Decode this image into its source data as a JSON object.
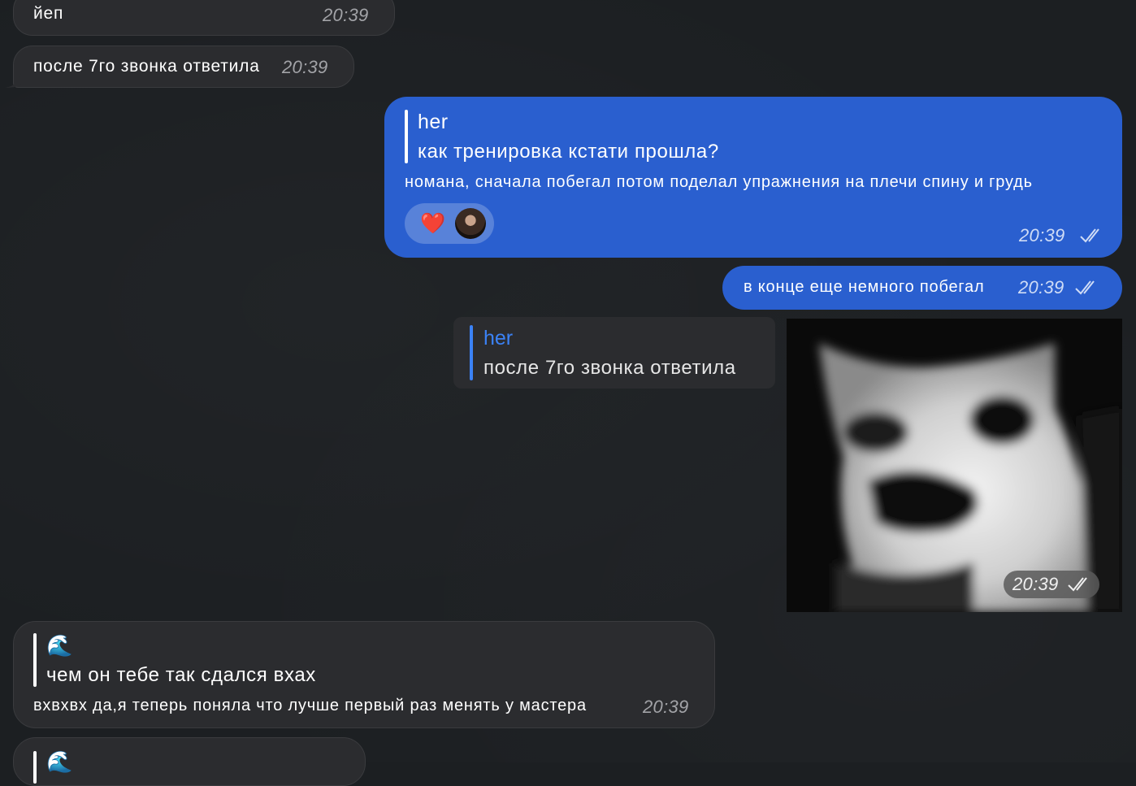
{
  "messages": {
    "m1": {
      "text": "йеп",
      "time": "20:39"
    },
    "m2": {
      "text": "после 7го звонка ответила",
      "time": "20:39"
    },
    "m3": {
      "reply_author": "her",
      "reply_text": "как тренировка кстати прошла?",
      "text": "номана, сначала побегал потом поделал упражнения на плечи спину и грудь",
      "reaction": "❤️",
      "time": "20:39"
    },
    "m4": {
      "text": "в конце еще немного побегал",
      "time": "20:39"
    },
    "m5": {
      "reply_author": "her",
      "reply_text": "после 7го звонка ответила",
      "time": "20:39"
    },
    "m6": {
      "reply_emoji": "🌊",
      "reply_text": "чем он тебе так сдался вхах",
      "text": "вхвхвх да,я теперь поняла что лучше первый раз менять у мастера",
      "time": "20:39"
    },
    "m7": {
      "reply_emoji": "🌊"
    }
  },
  "colors": {
    "background": "#1c1f22",
    "incoming_bubble": "#2b2c2f",
    "outgoing_bubble": "#2a5fcf",
    "reply_accent": "#3b82f6"
  }
}
